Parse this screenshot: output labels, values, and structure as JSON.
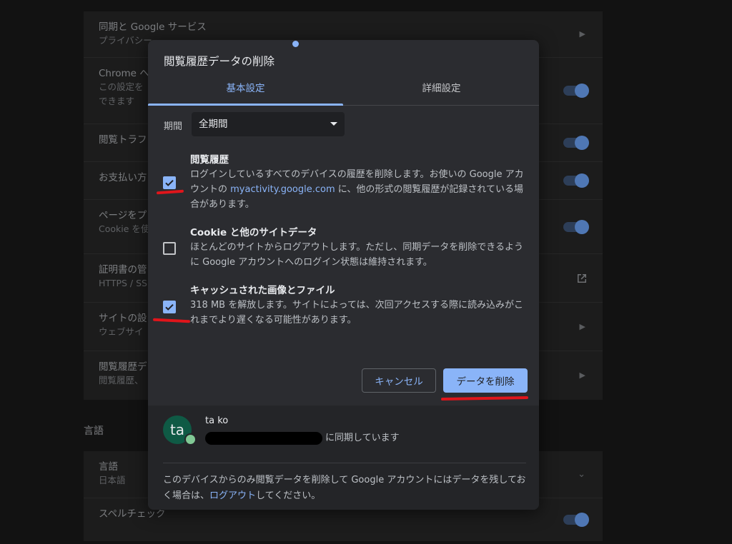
{
  "background": {
    "rows": [
      {
        "title": "同期と Google サービス",
        "sub": "プライバシー"
      },
      {
        "title": "Chrome へ",
        "sub": "この設定を",
        "sub2": "できます"
      },
      {
        "title": "閲覧トラフ",
        "sub": ""
      },
      {
        "title": "お支払い方",
        "sub": ""
      },
      {
        "title": "ページをプ",
        "sub": "Cookie を使"
      },
      {
        "title": "証明書の管",
        "sub": "HTTPS / SS"
      },
      {
        "title": "サイトの設",
        "sub": "ウェブサイ"
      },
      {
        "title": "閲覧履歴デ",
        "sub": "閲覧履歴、"
      }
    ],
    "language_section": "言語",
    "language_rows": [
      {
        "title": "言語",
        "sub": "日本語"
      },
      {
        "title": "スペルチェック",
        "sub": ""
      }
    ]
  },
  "dialog": {
    "title": "閲覧履歴データの削除",
    "tabs": {
      "basic": "基本設定",
      "advanced": "詳細設定"
    },
    "period": {
      "label": "期間",
      "value": "全期間"
    },
    "options": [
      {
        "title": "閲覧履歴",
        "desc_before": "ログインしているすべてのデバイスの履歴を削除します。お使いの Google アカウントの ",
        "link": "myactivity.google.com",
        "desc_after": " に、他の形式の閲覧履歴が記録されている場合があります。",
        "checked": true
      },
      {
        "title": "Cookie と他のサイトデータ",
        "desc": "ほとんどのサイトからログアウトします。ただし、同期データを削除できるように Google アカウントへのログイン状態は維持されます。",
        "checked": false
      },
      {
        "title": "キャッシュされた画像とファイル",
        "desc": "318 MB を解放します。サイトによっては、次回アクセスする際に読み込みがこれまでより遅くなる可能性があります。",
        "checked": true
      }
    ],
    "cancel_label": "キャンセル",
    "delete_label": "データを削除",
    "account": {
      "initials": "ta",
      "name": "ta ko",
      "sync_suffix": "に同期しています"
    },
    "footer_note_before": "このデバイスからのみ閲覧データを削除して Google アカウントにはデータを残しておく場合は、",
    "footer_note_link": "ログアウト",
    "footer_note_after": "してください。"
  },
  "colors": {
    "accent": "#8ab4f8",
    "annotation": "#e0151b",
    "dialog_bg": "#2b2c30"
  }
}
